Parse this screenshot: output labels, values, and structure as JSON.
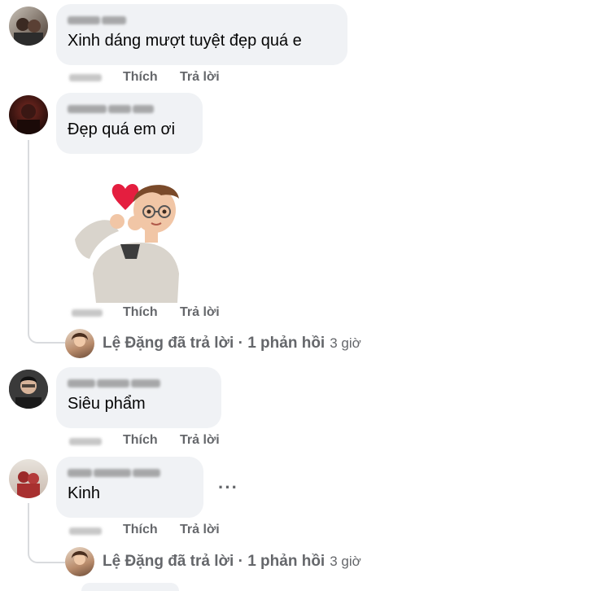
{
  "comments": [
    {
      "text": "Xinh dáng mượt tuyệt đẹp quá e",
      "like_label": "Thích",
      "reply_label": "Trả lời"
    },
    {
      "text": "Đẹp quá em ơi",
      "like_label": "Thích",
      "reply_label": "Trả lời",
      "replies_summary": {
        "text": "Lệ Đặng đã trả lời · 1 phản hồi",
        "time": "3 giờ"
      }
    },
    {
      "text": "Siêu phẩm",
      "like_label": "Thích",
      "reply_label": "Trả lời"
    },
    {
      "text": "Kinh",
      "like_label": "Thích",
      "reply_label": "Trả lời",
      "more_label": "···",
      "replies_summary": {
        "text": "Lệ Đặng đã trả lời · 1 phản hồi",
        "time": "3 giờ"
      }
    }
  ],
  "sticker": {
    "icon": "heart-hands-avatar-sticker"
  },
  "colors": {
    "bubble": "#f0f2f5",
    "secondary_text": "#65676b",
    "heart": "#e41e3f"
  }
}
